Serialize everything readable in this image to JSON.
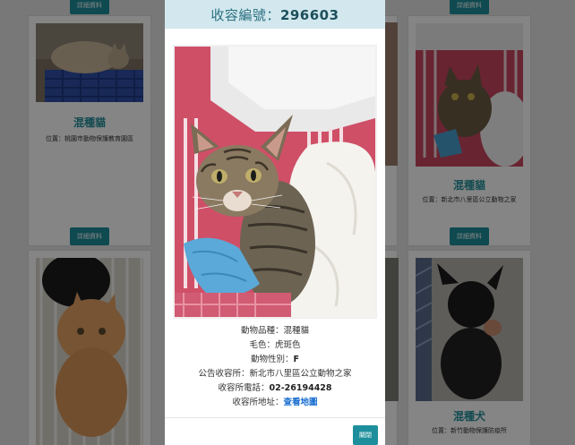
{
  "modal": {
    "title_label": "收容編號：",
    "title_id": "296603",
    "fields": [
      {
        "label": "動物品種：",
        "value": "混種貓"
      },
      {
        "label": "毛色：",
        "value": "虎斑色"
      },
      {
        "label": "動物性別：",
        "value": "F"
      },
      {
        "label": "公告收容所：",
        "value": "新北市八里區公立動物之家"
      },
      {
        "label": "收容所電話：",
        "value": "02-26194428"
      },
      {
        "label": "收容所地址：",
        "value": "查看地圖"
      }
    ],
    "close_label": "關閉"
  },
  "cards": [
    {
      "name": "混種貓",
      "location": "位置：桃園市動物保護教育園區",
      "button": "詳細資料"
    },
    {
      "name": "混種貓",
      "location": "位置：新北市八里區公立動物之家",
      "button": "詳細資料"
    },
    {
      "name": "混種犬",
      "location": "位置：新竹動物保護防疫所"
    }
  ],
  "top_buttons": [
    "詳細資料",
    "詳細資料"
  ],
  "colors": {
    "accent": "#1d8f9c",
    "header_bg": "#d2e8ee",
    "name_color": "#26909b",
    "link": "#1a6fd0"
  }
}
